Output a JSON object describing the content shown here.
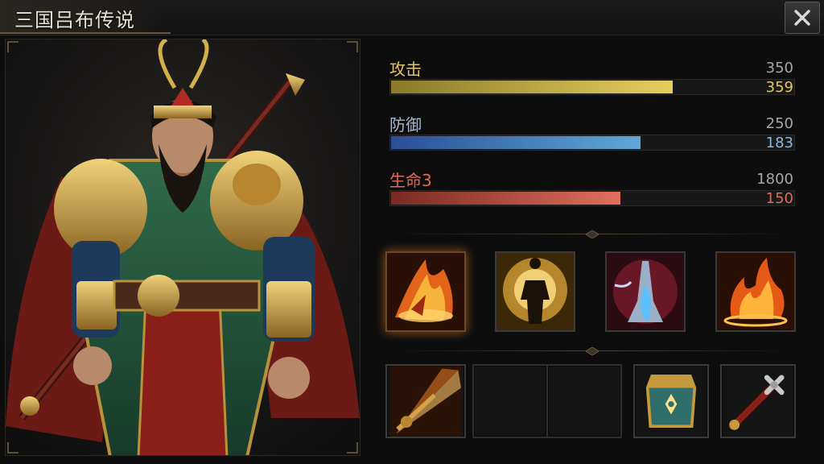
{
  "window": {
    "title": "三国吕布传说"
  },
  "stats": [
    {
      "label": "攻击",
      "max": "350",
      "current": "359",
      "fill": 0.7,
      "label_color": "#e0c46a",
      "current_color": "#e6c65c",
      "bar_start": "#8a7a2a",
      "bar_end": "#e4cf5e"
    },
    {
      "label": "防御",
      "max": "250",
      "current": "183",
      "fill": 0.62,
      "label_color": "#a9b8cc",
      "current_color": "#8fb8e0",
      "bar_start": "#2a4f96",
      "bar_end": "#5fa8d8"
    },
    {
      "label": "生命3",
      "max": "1800",
      "current": "150",
      "fill": 0.57,
      "label_color": "#e06a58",
      "current_color": "#e56a55",
      "bar_start": "#7a2a22",
      "bar_end": "#e0705c"
    }
  ],
  "skills": [
    {
      "icon": "fire-slash-icon"
    },
    {
      "icon": "golden-aura-warrior-icon"
    },
    {
      "icon": "blue-flame-rider-icon"
    },
    {
      "icon": "flame-burst-icon"
    }
  ],
  "equipment": [
    {
      "icon": "spear-thrust-icon"
    },
    {
      "icon": "empty-slot"
    },
    {
      "icon": "empty-slot"
    },
    {
      "icon": "jade-armor-chest-icon"
    },
    {
      "icon": "red-halberd-icon"
    }
  ],
  "colors": {
    "accent_gold": "#c9a34a",
    "panel_bg": "#0d0d0e"
  }
}
